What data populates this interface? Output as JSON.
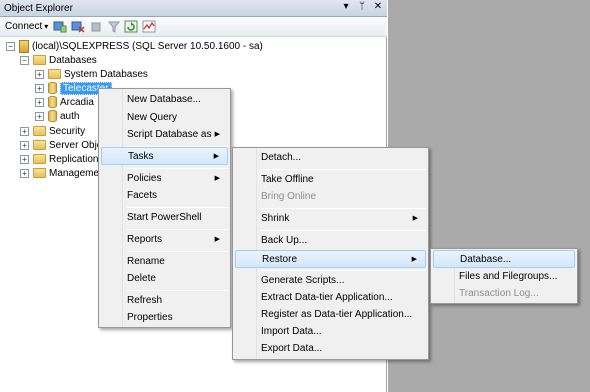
{
  "window": {
    "title": "Object Explorer",
    "pin_glyph": "▾",
    "autohide_glyph": "ᛘ",
    "close_glyph": "✕"
  },
  "toolbar": {
    "connect_label": "Connect",
    "connect_arrow": "▾",
    "icons": [
      "connect-object-explorer-icon",
      "disconnect-icon",
      "stop-icon",
      "filter-icon",
      "refresh-icon",
      "activity-monitor-icon"
    ]
  },
  "tree": {
    "server": "(local)\\SQLEXPRESS (SQL Server 10.50.1600 - sa)",
    "databases": "Databases",
    "system_databases": "System Databases",
    "telecaster": "Telecaster",
    "arcadia": "Arcadia",
    "auth": "auth",
    "security": "Security",
    "server_objects": "Server Obje",
    "replication": "Replication",
    "management": "Managemen",
    "expand_plus": "+",
    "expand_minus": "−"
  },
  "menu1": {
    "items": [
      {
        "label": "New Database..."
      },
      {
        "label": "New Query"
      },
      {
        "label": "Script Database as",
        "arrow": "▶"
      },
      {
        "label": "Tasks",
        "arrow": "▶"
      },
      {
        "label": "Policies",
        "arrow": "▶"
      },
      {
        "label": "Facets"
      },
      {
        "label": "Start PowerShell"
      },
      {
        "label": "Reports",
        "arrow": "▶"
      },
      {
        "label": "Rename"
      },
      {
        "label": "Delete"
      },
      {
        "label": "Refresh"
      },
      {
        "label": "Properties"
      }
    ]
  },
  "menu2": {
    "items": [
      {
        "label": "Detach..."
      },
      {
        "label": "Take Offline"
      },
      {
        "label": "Bring Online"
      },
      {
        "label": "Shrink",
        "arrow": "▶"
      },
      {
        "label": "Back Up..."
      },
      {
        "label": "Restore",
        "arrow": "▶"
      },
      {
        "label": "Generate Scripts..."
      },
      {
        "label": "Extract Data-tier Application..."
      },
      {
        "label": "Register as Data-tier Application..."
      },
      {
        "label": "Import Data..."
      },
      {
        "label": "Export Data..."
      }
    ]
  },
  "menu3": {
    "items": [
      {
        "label": "Database..."
      },
      {
        "label": "Files and Filegroups..."
      },
      {
        "label": "Transaction Log..."
      }
    ]
  }
}
